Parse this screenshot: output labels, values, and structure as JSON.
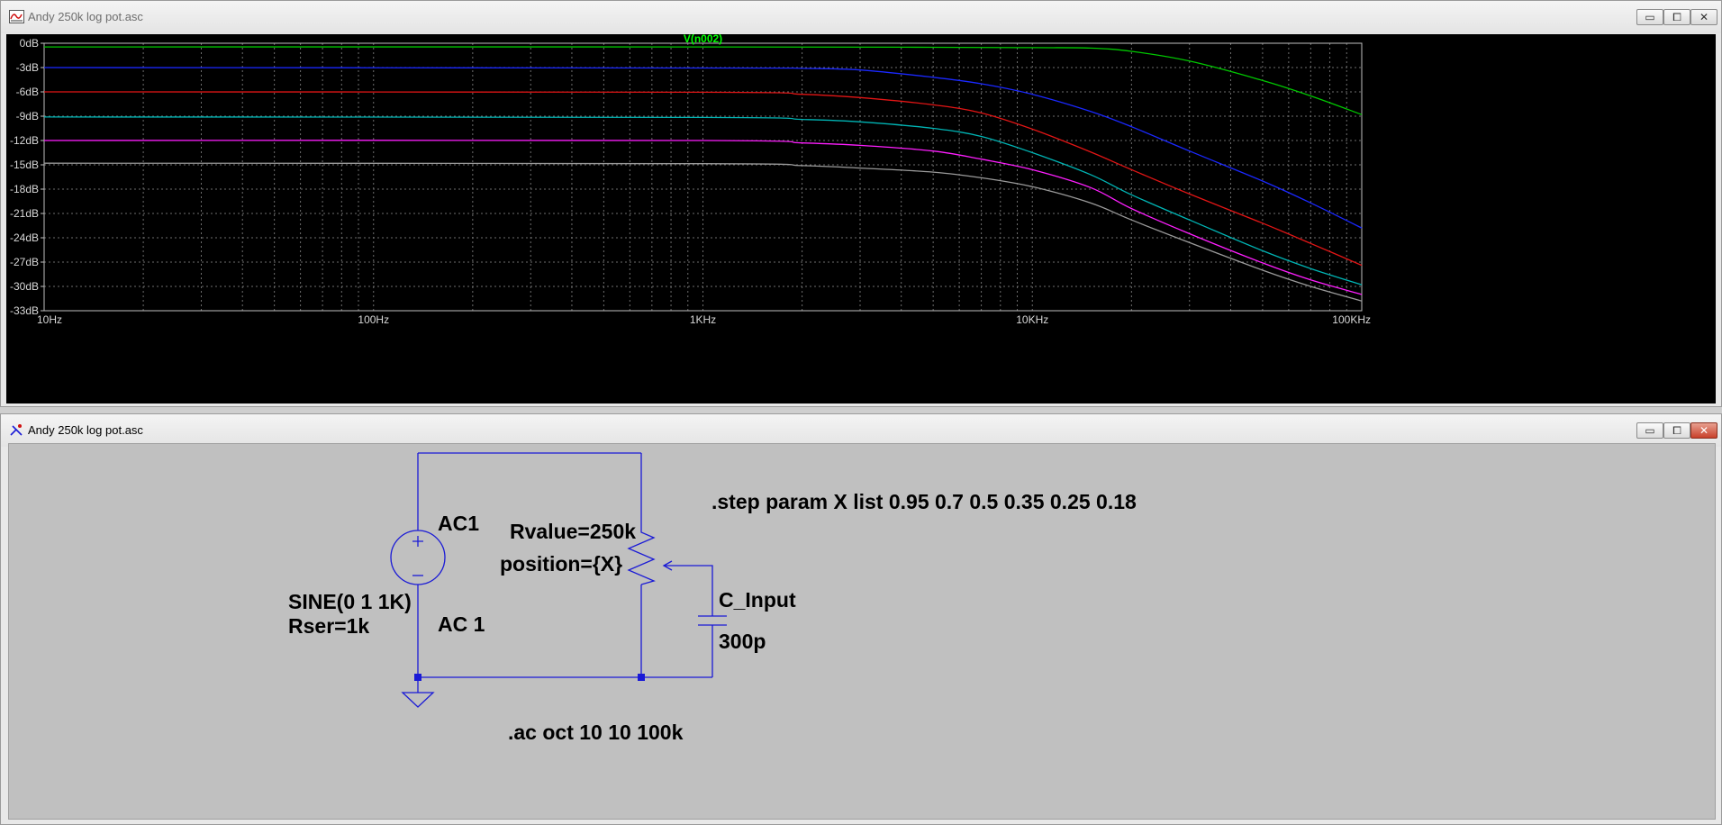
{
  "waveform_window": {
    "title": "Andy 250k log pot.asc",
    "icon": "waveform-icon",
    "buttons": {
      "minimize": "▭",
      "maximize": "⧠",
      "close": "✕"
    }
  },
  "schematic_window": {
    "title": "Andy 250k log pot.asc",
    "icon": "schematic-icon",
    "buttons": {
      "minimize": "▭",
      "maximize": "⧠",
      "close": "✕"
    }
  },
  "chart_data": {
    "type": "line",
    "title": "V(n002)",
    "title_color": "#00ff00",
    "x_scale": "log",
    "xlim": [
      10,
      100000
    ],
    "ylim": [
      -33,
      0
    ],
    "grid": true,
    "x_ticks": [
      {
        "value": 10,
        "label": "10Hz"
      },
      {
        "value": 100,
        "label": "100Hz"
      },
      {
        "value": 1000,
        "label": "1KHz"
      },
      {
        "value": 10000,
        "label": "10KHz"
      },
      {
        "value": 100000,
        "label": "100KHz"
      }
    ],
    "y_ticks": [
      {
        "value": 0,
        "label": "0dB"
      },
      {
        "value": -3,
        "label": "-3dB"
      },
      {
        "value": -6,
        "label": "-6dB"
      },
      {
        "value": -9,
        "label": "-9dB"
      },
      {
        "value": -12,
        "label": "-12dB"
      },
      {
        "value": -15,
        "label": "-15dB"
      },
      {
        "value": -18,
        "label": "-18dB"
      },
      {
        "value": -21,
        "label": "-21dB"
      },
      {
        "value": -24,
        "label": "-24dB"
      },
      {
        "value": -27,
        "label": "-27dB"
      },
      {
        "value": -30,
        "label": "-30dB"
      },
      {
        "value": -33,
        "label": "-33dB"
      }
    ],
    "series": [
      {
        "color": "#00c800",
        "x": [
          10,
          1000,
          5000,
          10000,
          15000,
          20000,
          30000,
          50000,
          70000,
          100000
        ],
        "y": [
          -0.45,
          -0.45,
          -0.5,
          -0.55,
          -0.6,
          -1.0,
          -2.2,
          -4.6,
          -6.5,
          -8.8
        ]
      },
      {
        "color": "#1a28ff",
        "x": [
          10,
          1000,
          2000,
          3000,
          5000,
          7000,
          10000,
          15000,
          20000,
          30000,
          50000,
          70000,
          100000
        ],
        "y": [
          -3.0,
          -3.05,
          -3.1,
          -3.3,
          -4.2,
          -5.0,
          -6.3,
          -8.4,
          -10.3,
          -13.3,
          -17.0,
          -19.7,
          -22.8
        ]
      },
      {
        "color": "#e21515",
        "x": [
          10,
          1000,
          2000,
          3000,
          5000,
          7000,
          10000,
          15000,
          20000,
          30000,
          50000,
          70000,
          100000
        ],
        "y": [
          -6.0,
          -6.05,
          -6.3,
          -6.7,
          -7.6,
          -8.6,
          -10.6,
          -13.4,
          -15.6,
          -18.6,
          -22.2,
          -24.7,
          -27.4
        ]
      },
      {
        "color": "#00b4b4",
        "x": [
          10,
          1000,
          2000,
          3000,
          5000,
          7000,
          10000,
          15000,
          20000,
          30000,
          50000,
          70000,
          100000
        ],
        "y": [
          -9.1,
          -9.15,
          -9.4,
          -9.7,
          -10.5,
          -11.5,
          -13.5,
          -16.2,
          -18.7,
          -21.8,
          -25.6,
          -27.8,
          -29.8
        ]
      },
      {
        "color": "#ff1eff",
        "x": [
          10,
          1000,
          2000,
          3000,
          5000,
          7000,
          10000,
          15000,
          20000,
          30000,
          50000,
          70000,
          100000
        ],
        "y": [
          -12.0,
          -12.0,
          -12.3,
          -12.6,
          -13.3,
          -14.3,
          -15.6,
          -17.8,
          -20.4,
          -23.5,
          -27.1,
          -29.2,
          -31.0
        ]
      },
      {
        "color": "#9a9a9a",
        "x": [
          10,
          1000,
          2000,
          3000,
          5000,
          7000,
          10000,
          15000,
          20000,
          30000,
          50000,
          70000,
          100000
        ],
        "y": [
          -14.8,
          -14.85,
          -15.1,
          -15.4,
          -15.9,
          -16.6,
          -17.7,
          -19.7,
          -21.8,
          -24.6,
          -28.0,
          -30.0,
          -31.8
        ]
      }
    ]
  },
  "schematic": {
    "wire_color": "#1a1ad6",
    "labels": {
      "step": ".step param X list  0.95 0.7 0.5 0.35 0.25 0.18",
      "ac1": "AC1",
      "sine": "SINE(0 1 1K)",
      "rser": "Rser=1k",
      "ac_amp": "AC 1",
      "rvalue": "Rvalue=250k",
      "position": "position={X}",
      "cap_name": "C_Input",
      "cap_value": "300p",
      "ac_directive": ".ac oct 10 10 100k"
    }
  }
}
